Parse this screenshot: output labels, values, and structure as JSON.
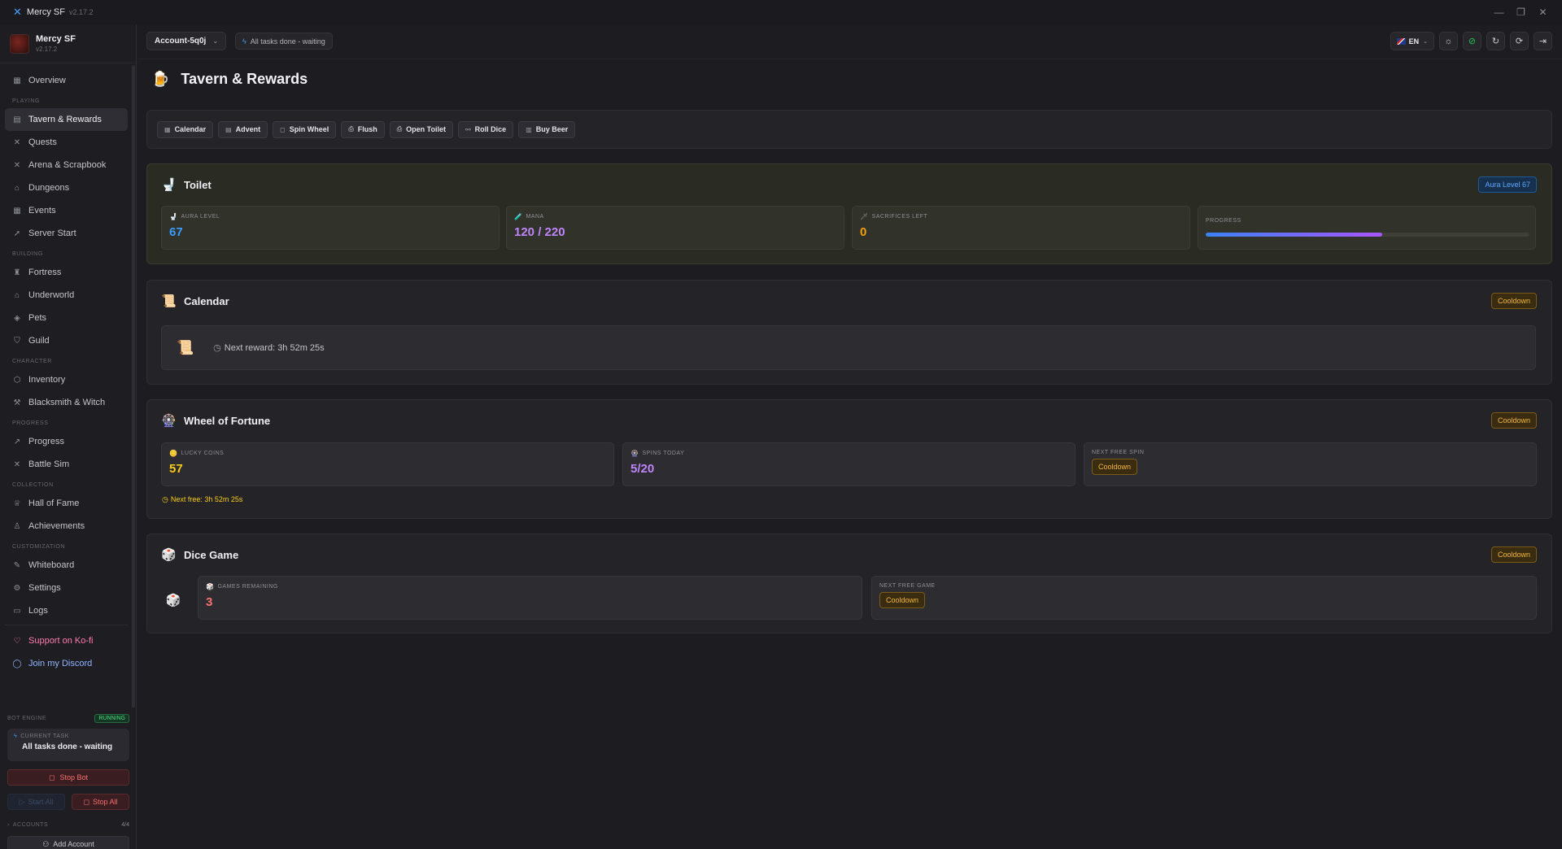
{
  "window": {
    "app_name": "Mercy SF",
    "version": "v2.17.2",
    "controls": {
      "minimize": "—",
      "maximize": "❐",
      "close": "✕"
    }
  },
  "sidebar": {
    "profile": {
      "name": "Mercy SF",
      "version": "v2.17.2"
    },
    "nav": [
      {
        "type": "item",
        "label": "Overview",
        "icon": "▦",
        "icon_name": "grid-icon"
      },
      {
        "type": "group",
        "label": "PLAYING"
      },
      {
        "type": "item",
        "label": "Tavern & Rewards",
        "icon": "▤",
        "icon_name": "tavern-icon",
        "active": true
      },
      {
        "type": "item",
        "label": "Quests",
        "icon": "✕",
        "icon_name": "swords-icon"
      },
      {
        "type": "item",
        "label": "Arena & Scrapbook",
        "icon": "✕",
        "icon_name": "arena-icon"
      },
      {
        "type": "item",
        "label": "Dungeons",
        "icon": "⌂",
        "icon_name": "mountain-icon"
      },
      {
        "type": "item",
        "label": "Events",
        "icon": "▦",
        "icon_name": "calendar-icon"
      },
      {
        "type": "item",
        "label": "Server Start",
        "icon": "➚",
        "icon_name": "rocket-icon"
      },
      {
        "type": "group",
        "label": "BUILDING"
      },
      {
        "type": "item",
        "label": "Fortress",
        "icon": "♜",
        "icon_name": "castle-icon"
      },
      {
        "type": "item",
        "label": "Underworld",
        "icon": "⌂",
        "icon_name": "underworld-icon"
      },
      {
        "type": "item",
        "label": "Pets",
        "icon": "◈",
        "icon_name": "paw-icon"
      },
      {
        "type": "item",
        "label": "Guild",
        "icon": "⛉",
        "icon_name": "shield-icon"
      },
      {
        "type": "group",
        "label": "CHARACTER"
      },
      {
        "type": "item",
        "label": "Inventory",
        "icon": "⬡",
        "icon_name": "package-icon"
      },
      {
        "type": "item",
        "label": "Blacksmith & Witch",
        "icon": "⚒",
        "icon_name": "hammer-icon"
      },
      {
        "type": "group",
        "label": "PROGRESS"
      },
      {
        "type": "item",
        "label": "Progress",
        "icon": "↗",
        "icon_name": "trend-icon"
      },
      {
        "type": "item",
        "label": "Battle Sim",
        "icon": "✕",
        "icon_name": "battle-icon"
      },
      {
        "type": "group",
        "label": "COLLECTION"
      },
      {
        "type": "item",
        "label": "Hall of Fame",
        "icon": "♕",
        "icon_name": "trophy-icon"
      },
      {
        "type": "item",
        "label": "Achievements",
        "icon": "♙",
        "icon_name": "medal-icon"
      },
      {
        "type": "group",
        "label": "CUSTOMIZATION"
      },
      {
        "type": "item",
        "label": "Whiteboard",
        "icon": "✎",
        "icon_name": "pen-icon"
      },
      {
        "type": "item",
        "label": "Settings",
        "icon": "⚙",
        "icon_name": "gear-icon"
      },
      {
        "type": "item",
        "label": "Logs",
        "icon": "▭",
        "icon_name": "logs-icon"
      },
      {
        "type": "spacer"
      },
      {
        "type": "item",
        "label": "Support on Ko-fi",
        "icon": "♡",
        "icon_name": "heart-icon",
        "style": "kofi"
      },
      {
        "type": "item",
        "label": "Join my Discord",
        "icon": "◯",
        "icon_name": "chat-icon",
        "style": "discord"
      }
    ],
    "engine": {
      "label": "BOT ENGINE",
      "status": "RUNNING",
      "current_task_label": "CURRENT TASK",
      "current_task": "All tasks done - waiting",
      "stop_bot": "Stop Bot",
      "start_all": "Start All",
      "stop_all": "Stop All",
      "accounts_label": "ACCOUNTS",
      "accounts_count": "4/4",
      "add_account": "Add Account"
    }
  },
  "topbar": {
    "account": "Account-5q0j",
    "status": "All tasks done - waiting",
    "language": "EN"
  },
  "page": {
    "title": "Tavern & Rewards",
    "actions": [
      {
        "label": "Calendar",
        "icon": "▦"
      },
      {
        "label": "Advent",
        "icon": "▤"
      },
      {
        "label": "Spin Wheel",
        "icon": "◻"
      },
      {
        "label": "Flush",
        "icon": "⎙"
      },
      {
        "label": "Open Toilet",
        "icon": "⎙"
      },
      {
        "label": "Roll Dice",
        "icon": "⚯"
      },
      {
        "label": "Buy Beer",
        "icon": "▥"
      }
    ]
  },
  "toilet": {
    "title": "Toilet",
    "badge": "Aura Level 67",
    "aura_label": "AURA LEVEL",
    "aura_value": "67",
    "mana_label": "MANA",
    "mana_value": "120 / 220",
    "sacrifices_label": "SACRIFICES LEFT",
    "sacrifices_value": "0",
    "progress_label": "PROGRESS",
    "progress_fraction": 0.545,
    "colors": {
      "aura": "#3b9cff",
      "mana": "#c084fc",
      "sacrifices": "#f59e0b"
    }
  },
  "calendar": {
    "title": "Calendar",
    "badge": "Cooldown",
    "next_reward": "Next reward: 3h 52m 25s"
  },
  "wheel": {
    "title": "Wheel of Fortune",
    "badge": "Cooldown",
    "coins_label": "LUCKY COINS",
    "coins_value": "57",
    "spins_label": "SPINS TODAY",
    "spins_value": "5/20",
    "next_spin_label": "NEXT FREE SPIN",
    "next_spin_value": "Cooldown",
    "next_free": "Next free: 3h 52m 25s"
  },
  "dice": {
    "title": "Dice Game",
    "badge": "Cooldown",
    "games_label": "GAMES REMAINING",
    "games_value": "3",
    "next_game_label": "NEXT FREE GAME",
    "next_game_value": "Cooldown"
  }
}
